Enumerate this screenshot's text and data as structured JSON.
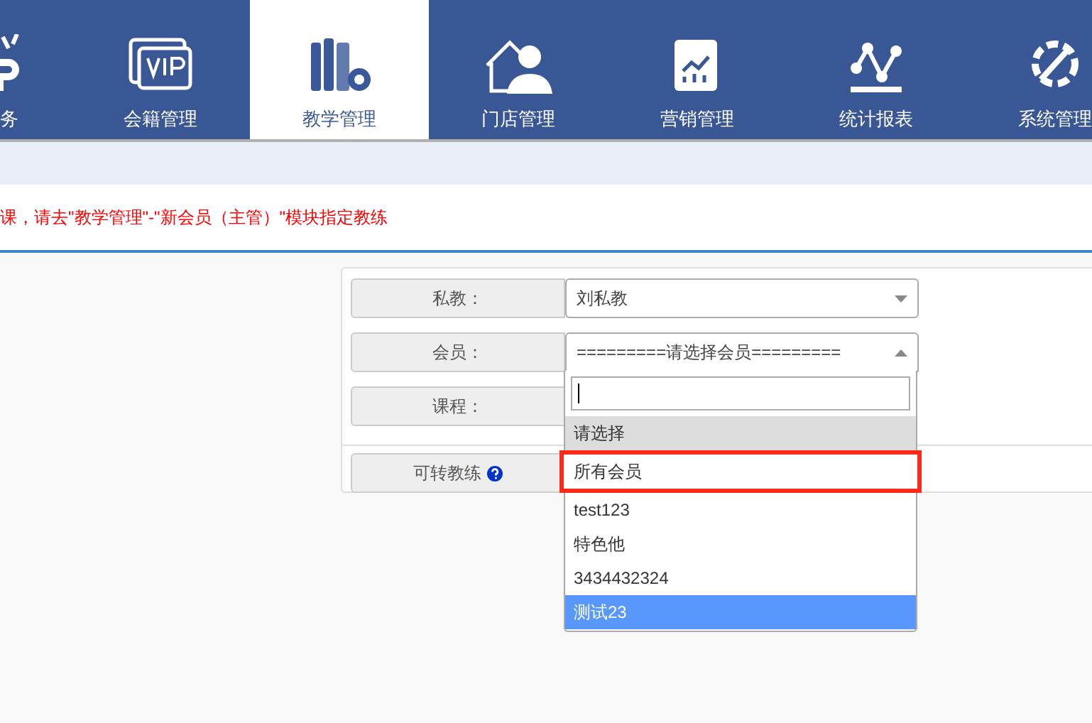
{
  "nav": {
    "tabs": [
      {
        "label": "务",
        "kind": "vip",
        "selected": false
      },
      {
        "label": "会籍管理",
        "kind": "card",
        "selected": false
      },
      {
        "label": "教学管理",
        "kind": "books",
        "selected": true
      },
      {
        "label": "门店管理",
        "kind": "store",
        "selected": false
      },
      {
        "label": "营销管理",
        "kind": "chart",
        "selected": false
      },
      {
        "label": "统计报表",
        "kind": "stats",
        "selected": false
      },
      {
        "label": "系统管理",
        "kind": "tools",
        "selected": false
      }
    ]
  },
  "notice": "课，请去\"教学管理\"-\"新会员（主管）\"模块指定教练",
  "form": {
    "rows": [
      {
        "label": "私教：",
        "value": "刘私教",
        "open": false
      },
      {
        "label": "会员：",
        "value": "=========请选择会员=========",
        "open": true
      },
      {
        "label": "课程："
      },
      {
        "label": "可转教练",
        "help": true
      }
    ]
  },
  "dropdown": {
    "options": [
      {
        "label": "请选择",
        "selected": true,
        "highlighted": false,
        "annotated": false
      },
      {
        "label": "所有会员",
        "selected": false,
        "highlighted": false,
        "annotated": true
      },
      {
        "label": "test123",
        "selected": false,
        "highlighted": false,
        "annotated": false
      },
      {
        "label": "特色他",
        "selected": false,
        "highlighted": false,
        "annotated": false
      },
      {
        "label": "3434432324",
        "selected": false,
        "highlighted": false,
        "annotated": false
      },
      {
        "label": "测试23",
        "selected": false,
        "highlighted": true,
        "annotated": false
      }
    ]
  }
}
